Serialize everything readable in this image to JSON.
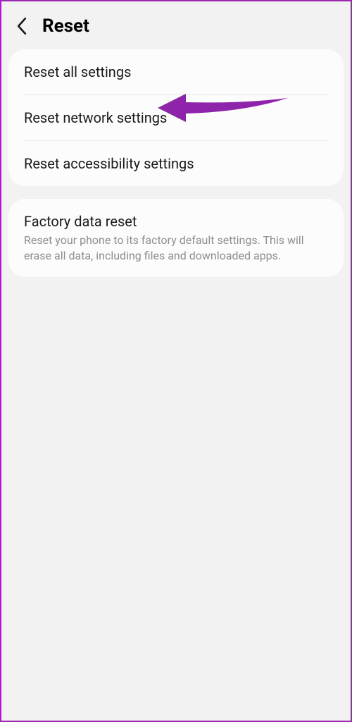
{
  "header": {
    "title": "Reset"
  },
  "group1": {
    "items": [
      {
        "title": "Reset all settings"
      },
      {
        "title": "Reset network settings"
      },
      {
        "title": "Reset accessibility settings"
      }
    ]
  },
  "group2": {
    "items": [
      {
        "title": "Factory data reset",
        "subtitle": "Reset your phone to its factory default settings. This will erase all data, including files and downloaded apps."
      }
    ]
  },
  "annotation": {
    "color": "#8e24aa"
  }
}
